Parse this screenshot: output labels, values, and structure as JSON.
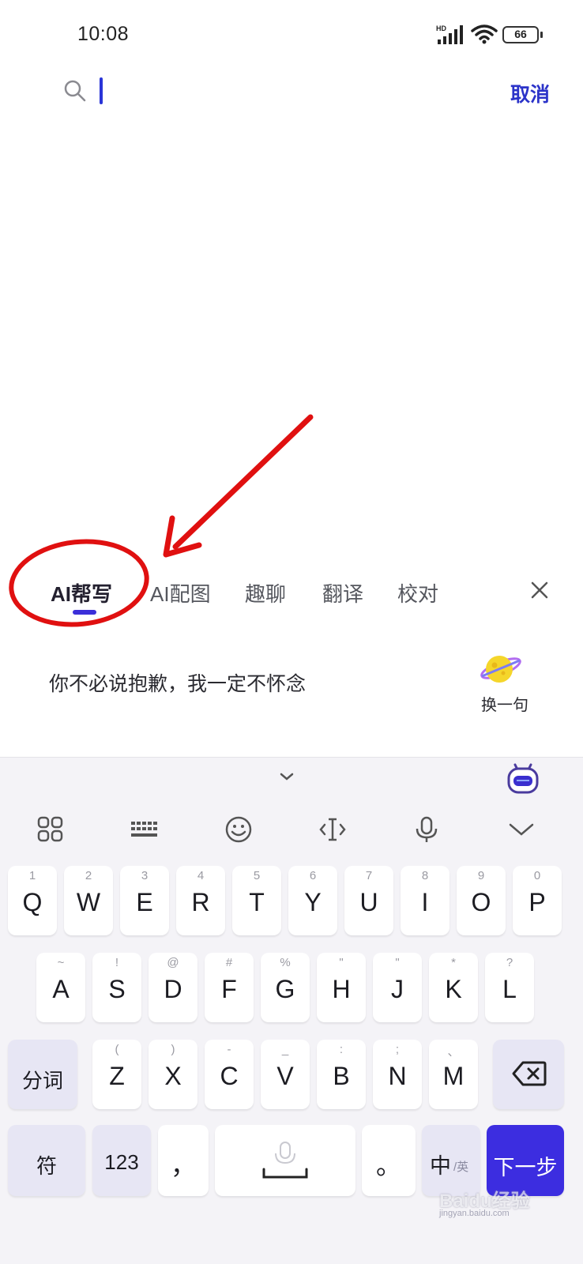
{
  "status_bar": {
    "time": "10:08",
    "network": "HD",
    "battery": "66"
  },
  "search": {
    "value": "",
    "cancel_label": "取消"
  },
  "ai_panel": {
    "tabs": [
      {
        "label": "AI帮写",
        "active": true
      },
      {
        "label": "AI配图",
        "active": false
      },
      {
        "label": "趣聊",
        "active": false
      },
      {
        "label": "翻译",
        "active": false
      },
      {
        "label": "校对",
        "active": false
      }
    ],
    "suggestion": "你不必说抱歉，我一定不怀念",
    "refresh_label": "换一句"
  },
  "keyboard": {
    "toolbar": [
      "apps-grid-icon",
      "keyboard-icon",
      "emoji-icon",
      "cursor-icon",
      "mic-icon",
      "collapse-icon"
    ],
    "row1": [
      {
        "main": "Q",
        "hint": "1"
      },
      {
        "main": "W",
        "hint": "2"
      },
      {
        "main": "E",
        "hint": "3"
      },
      {
        "main": "R",
        "hint": "4"
      },
      {
        "main": "T",
        "hint": "5"
      },
      {
        "main": "Y",
        "hint": "6"
      },
      {
        "main": "U",
        "hint": "7"
      },
      {
        "main": "I",
        "hint": "8"
      },
      {
        "main": "O",
        "hint": "9"
      },
      {
        "main": "P",
        "hint": "0"
      }
    ],
    "row2": [
      {
        "main": "A",
        "hint": "~"
      },
      {
        "main": "S",
        "hint": "!"
      },
      {
        "main": "D",
        "hint": "@"
      },
      {
        "main": "F",
        "hint": "#"
      },
      {
        "main": "G",
        "hint": "%"
      },
      {
        "main": "H",
        "hint": "\""
      },
      {
        "main": "J",
        "hint": "\""
      },
      {
        "main": "K",
        "hint": "*"
      },
      {
        "main": "L",
        "hint": "?"
      }
    ],
    "row3": {
      "left": "分词",
      "letters": [
        {
          "main": "Z",
          "hint": "("
        },
        {
          "main": "X",
          "hint": ")"
        },
        {
          "main": "C",
          "hint": "-"
        },
        {
          "main": "V",
          "hint": "_"
        },
        {
          "main": "B",
          "hint": ":"
        },
        {
          "main": "N",
          "hint": ";"
        },
        {
          "main": "M",
          "hint": "、"
        }
      ]
    },
    "row4": {
      "symbols": "符",
      "numbers": "123",
      "comma": "，",
      "period": "。",
      "lang_main": "中",
      "lang_alt": "/英",
      "enter": "下一步"
    }
  },
  "watermark": {
    "text": "Baidu经验",
    "sub": "jingyan.baidu.com"
  },
  "colors": {
    "accent": "#3c2de0",
    "annotation": "#e01010"
  }
}
